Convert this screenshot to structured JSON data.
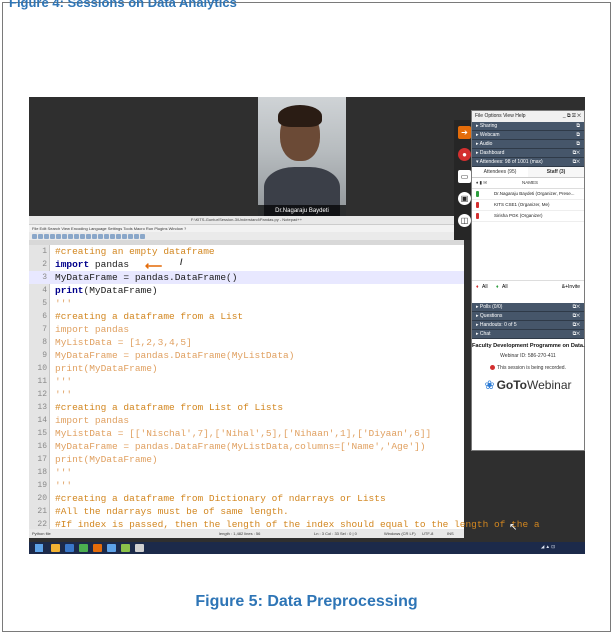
{
  "document": {
    "top_caption": "Figure 4: Sessions on Data Analytics",
    "figure_caption": "Figure 5: Data Preprocessing"
  },
  "webcam": {
    "presenter_label": "Dr.Nagaraju Baydeti"
  },
  "notepad": {
    "window_title": "F:\\KITS-Guntur\\Session-3\\Understand\\Pandas.py - Notepad++",
    "menu": "File  Edit  Search  View  Encoding  Language  Settings  Tools  Macro  Run  Plugins  Window  ?",
    "tab_label": "UnderstandPandas.py",
    "lines": [
      {
        "n": "1",
        "parts": [
          {
            "t": "#creating an empty dataframe",
            "c": "c-comment"
          }
        ]
      },
      {
        "n": "2",
        "parts": [
          {
            "t": "import",
            "c": "c-kw"
          },
          {
            "t": " pandas",
            "c": "c-plain"
          }
        ]
      },
      {
        "n": "3",
        "parts": [
          {
            "t": "MyDataFrame = pandas.DataFrame()",
            "c": "c-plain"
          }
        ],
        "hl": true
      },
      {
        "n": "4",
        "parts": [
          {
            "t": "print",
            "c": "c-kw"
          },
          {
            "t": "(MyDataFrame)",
            "c": "c-plain"
          }
        ]
      },
      {
        "n": "5",
        "parts": [
          {
            "t": "'''",
            "c": "c-dim"
          }
        ]
      },
      {
        "n": "6",
        "parts": [
          {
            "t": "#creating a dataframe from a List",
            "c": "c-comment"
          }
        ]
      },
      {
        "n": "7",
        "parts": [
          {
            "t": "import pandas",
            "c": "c-dim"
          }
        ]
      },
      {
        "n": "8",
        "parts": [
          {
            "t": "MyListData = [1,2,3,4,5]",
            "c": "c-dim"
          }
        ]
      },
      {
        "n": "9",
        "parts": [
          {
            "t": "MyDataFrame = pandas.DataFrame(MyListData)",
            "c": "c-dim"
          }
        ]
      },
      {
        "n": "10",
        "parts": [
          {
            "t": "print(MyDataFrame)",
            "c": "c-dim"
          }
        ]
      },
      {
        "n": "11",
        "parts": [
          {
            "t": "'''",
            "c": "c-dim"
          }
        ]
      },
      {
        "n": "12",
        "parts": [
          {
            "t": "'''",
            "c": "c-dim"
          }
        ]
      },
      {
        "n": "13",
        "parts": [
          {
            "t": "#creating a dataframe from List of Lists",
            "c": "c-comment"
          }
        ]
      },
      {
        "n": "14",
        "parts": [
          {
            "t": "import pandas",
            "c": "c-dim"
          }
        ]
      },
      {
        "n": "15",
        "parts": [
          {
            "t": "MyListData = [['Nischal',7],['Nihal',5],['Nihaan',1],['Diyaan',6]]",
            "c": "c-dim"
          }
        ]
      },
      {
        "n": "16",
        "parts": [
          {
            "t": "MyDataFrame = pandas.DataFrame(MyListData,columns=['Name','Age'])",
            "c": "c-dim"
          }
        ]
      },
      {
        "n": "17",
        "parts": [
          {
            "t": "print(MyDataFrame)",
            "c": "c-dim"
          }
        ]
      },
      {
        "n": "18",
        "parts": [
          {
            "t": "'''",
            "c": "c-dim"
          }
        ]
      },
      {
        "n": "19",
        "parts": [
          {
            "t": "'''",
            "c": "c-dim"
          }
        ]
      },
      {
        "n": "20",
        "parts": [
          {
            "t": "#creating a dataframe from Dictionary of ndarrays or Lists",
            "c": "c-comment"
          }
        ]
      },
      {
        "n": "21",
        "parts": [
          {
            "t": "#All the ndarrays must be of same length.",
            "c": "c-comment"
          }
        ]
      },
      {
        "n": "22",
        "parts": [
          {
            "t": "#If index is passed, then the length of the index should equal to the length of the a",
            "c": "c-comment"
          }
        ]
      }
    ],
    "status": {
      "file_type": "Python file",
      "length": "length : 1,482   lines : 56",
      "position": "Ln : 3   Col : 33   Sel : 0 | 0",
      "eol": "Windows (CR LF)",
      "encoding": "UTF-8",
      "mode": "INS"
    }
  },
  "gotowebinar": {
    "menu": "File  Options  View  Help",
    "window_controls": "_ ⧉ ☒ ✕",
    "sections_top": [
      "Sharing",
      "Webcam",
      "Audio",
      "Dashboard"
    ],
    "attendees_header": "Attendees: 98 of 1001 (max)",
    "tabs": [
      "Attendees (95)",
      "Staff (3)"
    ],
    "names_label": "NAMES",
    "staff": [
      "Dr.Nagaraju Baydeti (Organizer, Prese...",
      "KITS CSE1 (Organizer, Me)",
      "Sirisha PGK (Organizer)"
    ],
    "footer_left": "All",
    "footer_mid": "All",
    "invite_label": "Invite",
    "sections_bottom": [
      "Polls (0/0)",
      "Questions",
      "Handouts: 0 of 5",
      "Chat"
    ],
    "session_title": "Faculty Development Programme on Data...",
    "webinar_id": "Webinar ID: 586-270-411",
    "recording_note": "This session is being recorded.",
    "logo_bold": "GoTo",
    "logo_light": "Webinar"
  },
  "colors": {
    "caption_blue": "#2e75b6",
    "comment_orange": "#d2861f",
    "keyword_blue": "#00008b"
  },
  "icons": [
    "arrow-icon",
    "mic-icon",
    "camera-icon",
    "screen-icon",
    "window-icon",
    "windows-start-icon",
    "mouse-cursor-icon"
  ]
}
